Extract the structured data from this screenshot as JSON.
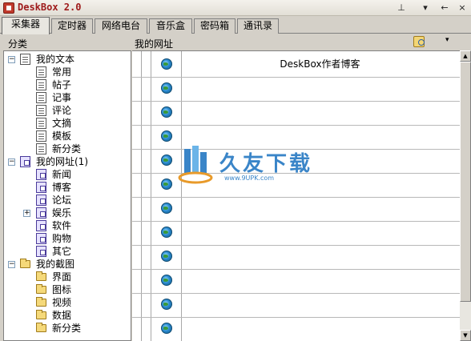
{
  "window": {
    "title": "DeskBox 2.0",
    "pin_glyph": "⊥",
    "dropdown_glyph": "▾",
    "back_glyph": "←",
    "close_glyph": "×"
  },
  "tabs": [
    {
      "label": "采集器",
      "active": true
    },
    {
      "label": "定时器"
    },
    {
      "label": "网络电台"
    },
    {
      "label": "音乐盒"
    },
    {
      "label": "密码箱"
    },
    {
      "label": "通讯录"
    }
  ],
  "headers": {
    "category": "分类",
    "my_urls": "我的网址",
    "dropdown_glyph": "▾"
  },
  "tree": [
    {
      "label": "我的文本",
      "icon": "doc",
      "level": 0,
      "expanded": true
    },
    {
      "label": "常用",
      "icon": "doc",
      "level": 1
    },
    {
      "label": "帖子",
      "icon": "doc",
      "level": 1
    },
    {
      "label": "记事",
      "icon": "doc",
      "level": 1
    },
    {
      "label": "评论",
      "icon": "doc",
      "level": 1
    },
    {
      "label": "文摘",
      "icon": "doc",
      "level": 1
    },
    {
      "label": "模板",
      "icon": "doc",
      "level": 1
    },
    {
      "label": "新分类",
      "icon": "doc",
      "level": 1
    },
    {
      "label": "我的网址(1)",
      "icon": "link",
      "level": 0,
      "expanded": true
    },
    {
      "label": "新闻",
      "icon": "link",
      "level": 1
    },
    {
      "label": "博客",
      "icon": "link",
      "level": 1
    },
    {
      "label": "论坛",
      "icon": "link",
      "level": 1
    },
    {
      "label": "娱乐",
      "icon": "link",
      "level": 1,
      "collapsed_child": true
    },
    {
      "label": "软件",
      "icon": "link",
      "level": 1
    },
    {
      "label": "购物",
      "icon": "link",
      "level": 1
    },
    {
      "label": "其它",
      "icon": "link",
      "level": 1
    },
    {
      "label": "我的截图",
      "icon": "folder",
      "level": 0,
      "expanded": true
    },
    {
      "label": "界面",
      "icon": "folder",
      "level": 1
    },
    {
      "label": "图标",
      "icon": "folder",
      "level": 1
    },
    {
      "label": "视频",
      "icon": "folder",
      "level": 1
    },
    {
      "label": "数据",
      "icon": "folder",
      "level": 1
    },
    {
      "label": "新分类",
      "icon": "folder",
      "level": 1
    }
  ],
  "url_rows": [
    {
      "title": "DeskBox作者博客"
    },
    {
      "title": ""
    },
    {
      "title": ""
    },
    {
      "title": ""
    },
    {
      "title": ""
    },
    {
      "title": ""
    },
    {
      "title": ""
    },
    {
      "title": ""
    },
    {
      "title": ""
    },
    {
      "title": ""
    },
    {
      "title": ""
    },
    {
      "title": ""
    }
  ],
  "scrollbar": {
    "up_glyph": "▲",
    "down_glyph": "▼"
  },
  "watermark": {
    "text": "久友下载",
    "url": "www.9UPK.com"
  }
}
